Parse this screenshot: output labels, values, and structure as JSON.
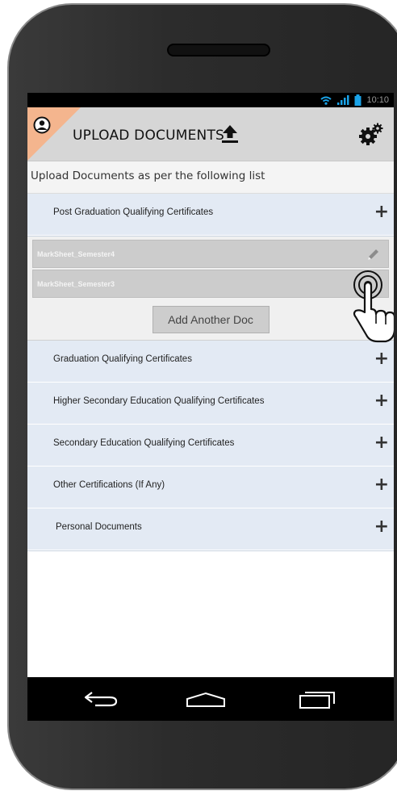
{
  "status_bar": {
    "time": "10:10"
  },
  "app_bar": {
    "title": "UPLOAD DOCUMENTS"
  },
  "instruction": "Upload Documents as per the following list",
  "sections": [
    {
      "label": "Post Graduation Qualifying Certificates",
      "expanded": true,
      "documents": [
        "MarkSheet_Semester4",
        "MarkSheet_Semester3"
      ],
      "add_button": "Add Another Doc"
    },
    {
      "label": "Graduation Qualifying Certificates"
    },
    {
      "label": "Higher Secondary Education Qualifying Certificates"
    },
    {
      "label": "Secondary Education Qualifying Certificates"
    },
    {
      "label": "Other Certifications (If Any)"
    },
    {
      "label": "Personal Documents"
    }
  ],
  "plus_symbol": "+",
  "icons": [
    "avatar-icon",
    "upload-icon",
    "settings-icon",
    "pencil-icon",
    "wifi-icon",
    "signal-icon",
    "battery-icon",
    "back-icon",
    "home-icon",
    "recent-apps-icon",
    "tap-gesture-icon"
  ],
  "colors": {
    "app_bar": "#d6d6d6",
    "accent_corner": "#f4b58e",
    "section_bg": "#e3eaf4",
    "doc_row": "#cccccc",
    "status_icons": "#1aa3e8"
  }
}
